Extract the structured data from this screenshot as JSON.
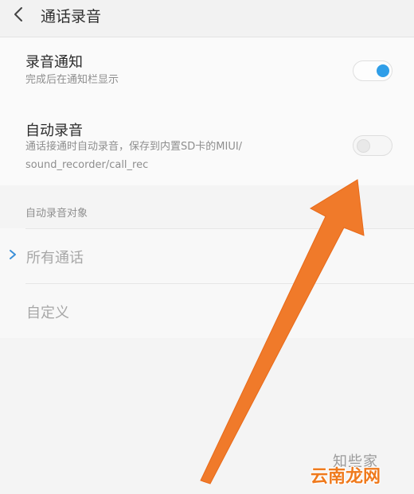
{
  "header": {
    "title": "通话录音",
    "back_icon": "back-arrow-icon"
  },
  "settings": {
    "record_notify": {
      "title": "录音通知",
      "desc": "完成后在通知栏显示",
      "enabled": true
    },
    "auto_record": {
      "title": "自动录音",
      "desc_line1": "通话接通时自动录音，保存到内置SD卡的MIUI/",
      "desc_line2": "sound_recorder/call_rec",
      "enabled": false
    }
  },
  "target_section": {
    "title": "自动录音对象",
    "items": [
      {
        "label": "所有通话",
        "selected": true
      },
      {
        "label": "自定义",
        "selected": false
      }
    ]
  },
  "watermark": {
    "brand_top": "知些家",
    "brand_bottom": "云南龙网"
  },
  "colors": {
    "toggle_on": "#2f9ee8",
    "arrow": "#f07a2a",
    "chevron": "#3a8fd8"
  }
}
